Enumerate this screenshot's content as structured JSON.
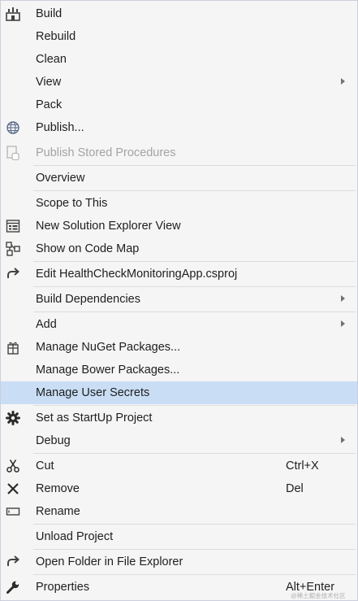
{
  "menu": {
    "build": "Build",
    "rebuild": "Rebuild",
    "clean": "Clean",
    "view": "View",
    "pack": "Pack",
    "publish": "Publish...",
    "publish_stored_procedures": "Publish Stored Procedures",
    "overview": "Overview",
    "scope_to_this": "Scope to This",
    "new_solution_explorer_view": "New Solution Explorer View",
    "show_on_code_map": "Show on Code Map",
    "edit_project_file": "Edit HealthCheckMonitoringApp.csproj",
    "build_dependencies": "Build Dependencies",
    "add": "Add",
    "manage_nuget_packages": "Manage NuGet Packages...",
    "manage_bower_packages": "Manage Bower Packages...",
    "manage_user_secrets": "Manage User Secrets",
    "set_as_startup_project": "Set as StartUp Project",
    "debug": "Debug",
    "cut": "Cut",
    "cut_shortcut": "Ctrl+X",
    "remove": "Remove",
    "remove_shortcut": "Del",
    "rename": "Rename",
    "unload_project": "Unload Project",
    "open_folder_in_file_explorer": "Open Folder in File Explorer",
    "properties": "Properties",
    "properties_shortcut": "Alt+Enter"
  },
  "highlighted_item": "Manage User Secrets",
  "disabled_items": [
    "Publish Stored Procedures"
  ],
  "submenu_items": [
    "View",
    "Build Dependencies",
    "Add",
    "Debug"
  ],
  "icons": {
    "build": "build-icon",
    "publish": "globe-icon",
    "publish_stored_procedures": "database-icon",
    "new_solution_explorer_view": "window-icon",
    "show_on_code_map": "code-map-icon",
    "edit_project_file": "redo-arrow-icon",
    "manage_nuget_packages": "package-icon",
    "set_as_startup_project": "gear-icon",
    "cut": "scissors-icon",
    "remove": "x-icon",
    "rename": "rename-icon",
    "open_folder_in_file_explorer": "redo-arrow-icon",
    "properties": "wrench-icon"
  },
  "colors": {
    "menu_background": "#f5f5f5",
    "highlight": "#c9def5",
    "text": "#1e1e1e",
    "disabled_text": "#a2a4a5",
    "separator": "#dcdce2"
  },
  "watermark": "@稀土掘金技术社区"
}
